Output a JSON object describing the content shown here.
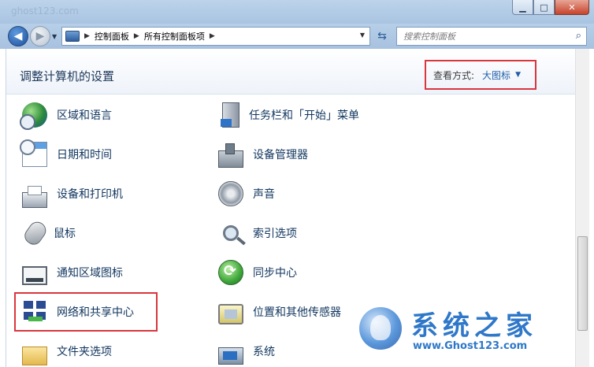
{
  "window": {
    "ghost_title": "ghost123.com",
    "minimize_glyph": "▁",
    "maximize_glyph": "□",
    "close_glyph": "✕"
  },
  "nav": {
    "back_glyph": "◀",
    "forward_glyph": "▶",
    "breadcrumb": [
      "控制面板",
      "所有控制面板项"
    ],
    "separator_glyph": "▶",
    "dropdown_glyph": "▼",
    "refresh_glyph": "⇆",
    "search_placeholder": "搜索控制面板",
    "search_glyph": "⌕"
  },
  "header": {
    "title": "调整计算机的设置",
    "view_by_label": "查看方式:",
    "view_by_value": "大图标",
    "view_by_caret": "▼"
  },
  "items_left": [
    {
      "label": "区域和语言",
      "icon": "globe-icon"
    },
    {
      "label": "日期和时间",
      "icon": "calendar-icon"
    },
    {
      "label": "设备和打印机",
      "icon": "printer-icon"
    },
    {
      "label": "鼠标",
      "icon": "mouse-icon"
    },
    {
      "label": "通知区域图标",
      "icon": "tray-icon"
    },
    {
      "label": "网络和共享中心",
      "icon": "network-icon"
    },
    {
      "label": "文件夹选项",
      "icon": "folder-icon"
    }
  ],
  "items_right": [
    {
      "label": "任务栏和「开始」菜单",
      "icon": "taskbar-icon"
    },
    {
      "label": "设备管理器",
      "icon": "device-manager-icon"
    },
    {
      "label": "声音",
      "icon": "speaker-icon"
    },
    {
      "label": "索引选项",
      "icon": "magnifier-icon"
    },
    {
      "label": "同步中心",
      "icon": "sync-icon"
    },
    {
      "label": "位置和其他传感器",
      "icon": "sensor-icon"
    },
    {
      "label": "系统",
      "icon": "system-icon"
    }
  ],
  "watermark": {
    "title": "系统之家",
    "url": "www.Ghost123.com"
  },
  "colors": {
    "highlight": "#d9363e",
    "link_text": "#11365f",
    "accent": "#1f5fa8"
  }
}
